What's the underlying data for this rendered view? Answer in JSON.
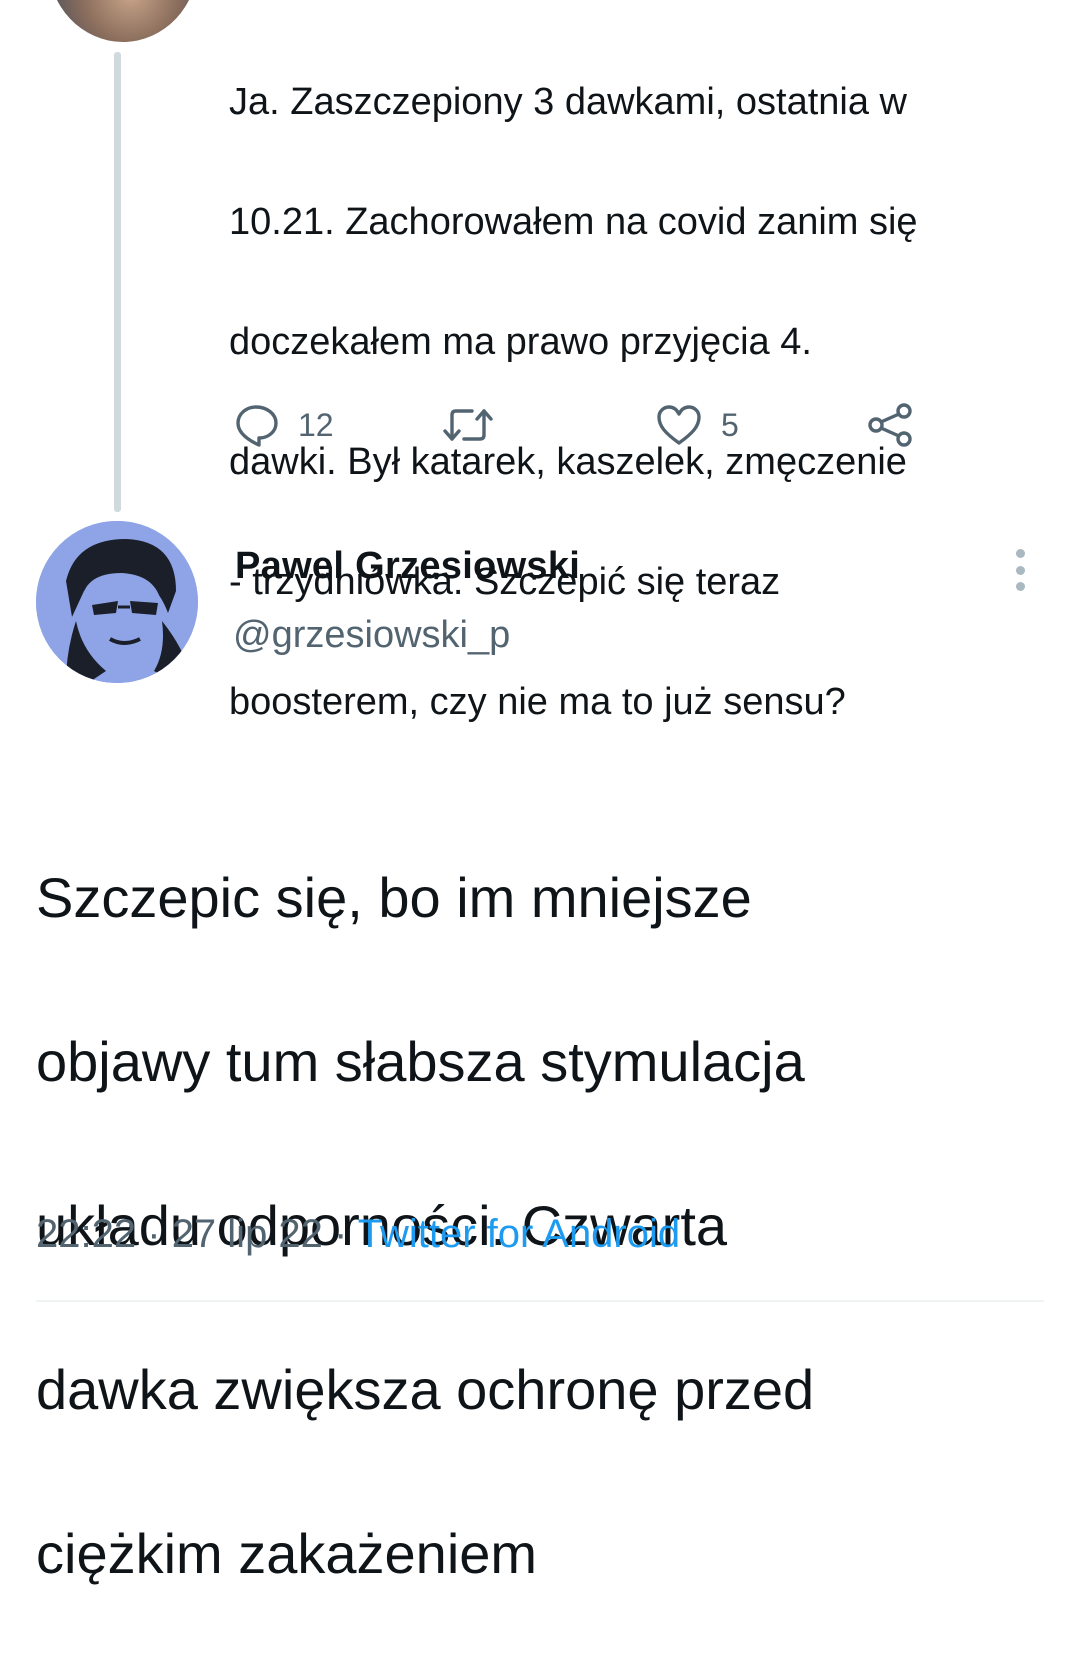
{
  "parent_tweet": {
    "text_lines": [
      "Ja. Zaszczepiony 3 dawkami, ostatnia w",
      "10.21. Zachorowałem na covid zanim się",
      "doczekałem ma prawo przyjęcia 4.",
      "dawki. Był katarek, kaszelek, zmęczenie",
      "- trzydniówka. Szczepić się teraz",
      "boosterem, czy nie ma to już sensu?"
    ],
    "actions": {
      "reply_count": "12",
      "retweet_count": "",
      "like_count": "5"
    }
  },
  "main_tweet": {
    "author_name": "Pawel Grzesiowski",
    "author_handle": "@grzesiowski_p",
    "text_lines": [
      "Szczepic się, bo im mniejsze",
      "objawy tum słabsza stymulacja",
      "układu odporności. Czwarta",
      "dawka zwiększa ochronę przed",
      "ciężkim zakażeniem"
    ],
    "time": "22:22",
    "date": "27 lip 22",
    "separator": "·",
    "source": "Twitter for Android"
  },
  "colors": {
    "text_primary": "#0f1419",
    "text_secondary": "#536471",
    "link": "#1d9bf0",
    "avatar_bg": "#8ea4e6",
    "thread_line": "#cfd9de"
  },
  "icons": {
    "reply": "reply-icon",
    "retweet": "retweet-icon",
    "like": "heart-icon",
    "share": "share-icon",
    "more": "more-vertical-icon"
  }
}
